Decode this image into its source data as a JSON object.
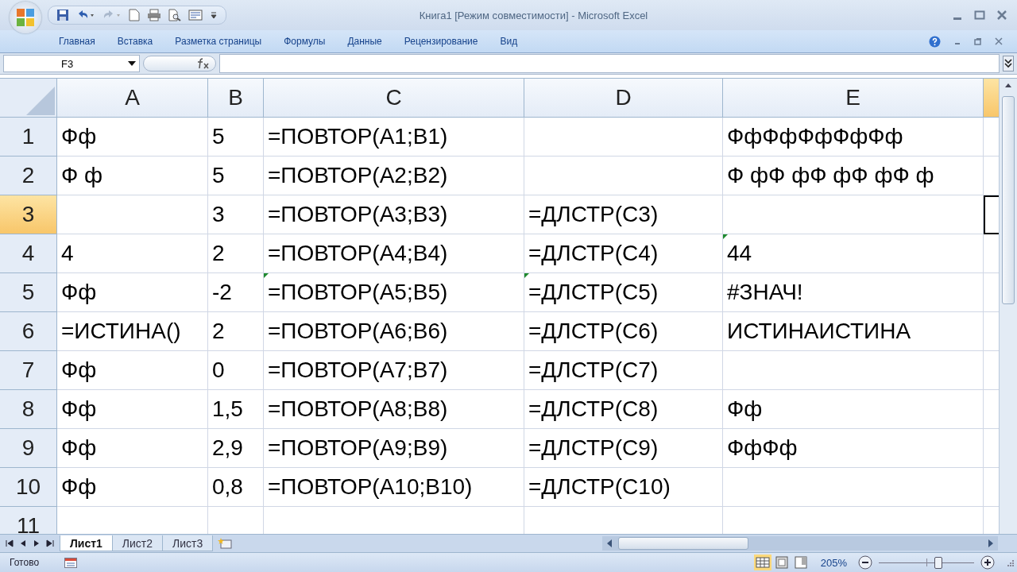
{
  "window": {
    "title": "Книга1  [Режим совместимости] - Microsoft Excel"
  },
  "ribbon_tabs": [
    {
      "label": "Главная",
      "selected": false
    },
    {
      "label": "Вставка",
      "selected": false
    },
    {
      "label": "Разметка страницы",
      "selected": false
    },
    {
      "label": "Формулы",
      "selected": false
    },
    {
      "label": "Данные",
      "selected": false
    },
    {
      "label": "Рецензирование",
      "selected": false
    },
    {
      "label": "Вид",
      "selected": false
    }
  ],
  "formula_bar": {
    "name_box": "F3"
  },
  "columns": [
    {
      "label": "A",
      "selected": false
    },
    {
      "label": "B",
      "selected": false
    },
    {
      "label": "C",
      "selected": false
    },
    {
      "label": "D",
      "selected": false
    },
    {
      "label": "E",
      "selected": false
    },
    {
      "selected": true
    }
  ],
  "rows": [
    {
      "header": "1",
      "selected": false,
      "cells": [
        {
          "text": "Фф"
        },
        {
          "text": "5"
        },
        {
          "text": "=ПОВТОР(A1;B1)"
        },
        {},
        {
          "text": "ФфФфФфФфФф"
        },
        {}
      ]
    },
    {
      "header": "2",
      "selected": false,
      "cells": [
        {
          "text": "Ф ф"
        },
        {
          "text": "5"
        },
        {
          "text": "=ПОВТОР(A2;B2)"
        },
        {},
        {
          "text": "Ф фФ фФ фФ фФ ф"
        },
        {}
      ]
    },
    {
      "header": "3",
      "selected": true,
      "cells": [
        {},
        {
          "text": "3"
        },
        {
          "text": "=ПОВТОР(A3;B3)"
        },
        {
          "text": "=ДЛСТР(C3)"
        },
        {},
        {}
      ]
    },
    {
      "header": "4",
      "selected": false,
      "cells": [
        {
          "text": "4"
        },
        {
          "text": "2"
        },
        {
          "text": "=ПОВТОР(A4;B4)"
        },
        {
          "text": "=ДЛСТР(C4)"
        },
        {
          "text": "44",
          "warning": true
        },
        {}
      ]
    },
    {
      "header": "5",
      "selected": false,
      "cells": [
        {
          "text": "Фф"
        },
        {
          "text": "-2"
        },
        {
          "text": "=ПОВТОР(A5;B5)",
          "warning": true
        },
        {
          "text": "=ДЛСТР(C5)",
          "warning": true
        },
        {
          "text": "#ЗНАЧ!"
        },
        {}
      ]
    },
    {
      "header": "6",
      "selected": false,
      "cells": [
        {
          "text": "=ИСТИНА()"
        },
        {
          "text": "2"
        },
        {
          "text": "=ПОВТОР(A6;B6)"
        },
        {
          "text": "=ДЛСТР(C6)"
        },
        {
          "text": "ИСТИНАИСТИНА"
        },
        {}
      ]
    },
    {
      "header": "7",
      "selected": false,
      "cells": [
        {
          "text": "Фф"
        },
        {
          "text": "0"
        },
        {
          "text": "=ПОВТОР(A7;B7)"
        },
        {
          "text": "=ДЛСТР(C7)"
        },
        {},
        {}
      ]
    },
    {
      "header": "8",
      "selected": false,
      "cells": [
        {
          "text": "Фф"
        },
        {
          "text": "1,5"
        },
        {
          "text": "=ПОВТОР(A8;B8)"
        },
        {
          "text": "=ДЛСТР(C8)"
        },
        {
          "text": "Фф"
        },
        {}
      ]
    },
    {
      "header": "9",
      "selected": false,
      "cells": [
        {
          "text": "Фф"
        },
        {
          "text": "2,9"
        },
        {
          "text": "=ПОВТОР(A9;B9)"
        },
        {
          "text": "=ДЛСТР(C9)"
        },
        {
          "text": "ФфФф"
        },
        {}
      ]
    },
    {
      "header": "10",
      "selected": false,
      "cells": [
        {
          "text": "Фф"
        },
        {
          "text": "0,8"
        },
        {
          "text": "=ПОВТОР(A10;B10)"
        },
        {
          "text": "=ДЛСТР(C10)"
        },
        {},
        {}
      ]
    },
    {
      "header": "11",
      "selected": false,
      "cells": [
        {},
        {},
        {},
        {},
        {},
        {}
      ]
    }
  ],
  "sheet_tabs": [
    {
      "label": "Лист1",
      "selected": true
    },
    {
      "label": "Лист2",
      "selected": false
    },
    {
      "label": "Лист3",
      "selected": false
    }
  ],
  "status_bar": {
    "status": "Готово",
    "zoom": "205%",
    "zoom_slider": {
      "level": 0.62
    }
  }
}
